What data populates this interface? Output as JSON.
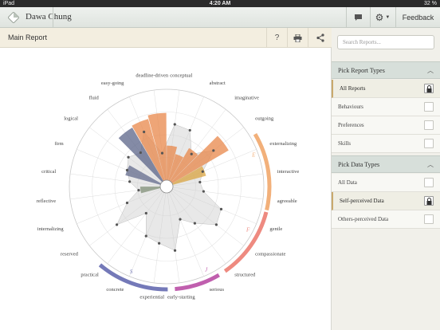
{
  "status": {
    "left": "iPad",
    "time": "4:20 AM",
    "battery": "32 %"
  },
  "app": {
    "user": "Dawa Chung",
    "feedback": "Feedback"
  },
  "main": {
    "title": "Main Report",
    "help": "?"
  },
  "sidebar": {
    "search_placeholder": "Search Reports...",
    "report_types": {
      "title": "Pick Report Types",
      "items": [
        "All Reports",
        "Behaviours",
        "Preferences",
        "Skills"
      ]
    },
    "data_types": {
      "title": "Pick Data Types",
      "items": [
        "All Data",
        "Self-perceived Data",
        "Others-perceived Data"
      ]
    }
  },
  "chart_data": {
    "type": "radial",
    "categories": [
      "easy-going",
      "deadline-driven",
      "conceptual",
      "abstract",
      "imaginative",
      "outgoing",
      "externalizing",
      "interactive",
      "agreeable",
      "gentle",
      "compassionate",
      "structured",
      "serious",
      "early-starting",
      "experiential",
      "concrete",
      "practical",
      "reserved",
      "internalizing",
      "reflective",
      "critical",
      "firm",
      "logical",
      "fluid"
    ],
    "self_values": [
      70,
      74,
      38,
      30,
      42,
      72,
      38,
      12,
      12,
      18,
      20,
      48,
      74,
      28,
      34,
      30,
      18,
      42,
      18,
      22,
      14,
      40,
      48,
      68
    ],
    "others_values": [
      58,
      30,
      62,
      60,
      38,
      58,
      36,
      30,
      34,
      58,
      62,
      44,
      32,
      64,
      56,
      52,
      30,
      62,
      40,
      24,
      34,
      40,
      46,
      40
    ],
    "quadrant_letters": [
      "E",
      "F",
      "J",
      "S"
    ],
    "quadrant_colors": [
      "#f2b07a",
      "#ee8a80",
      "#c05fae",
      "#7479b8"
    ]
  }
}
